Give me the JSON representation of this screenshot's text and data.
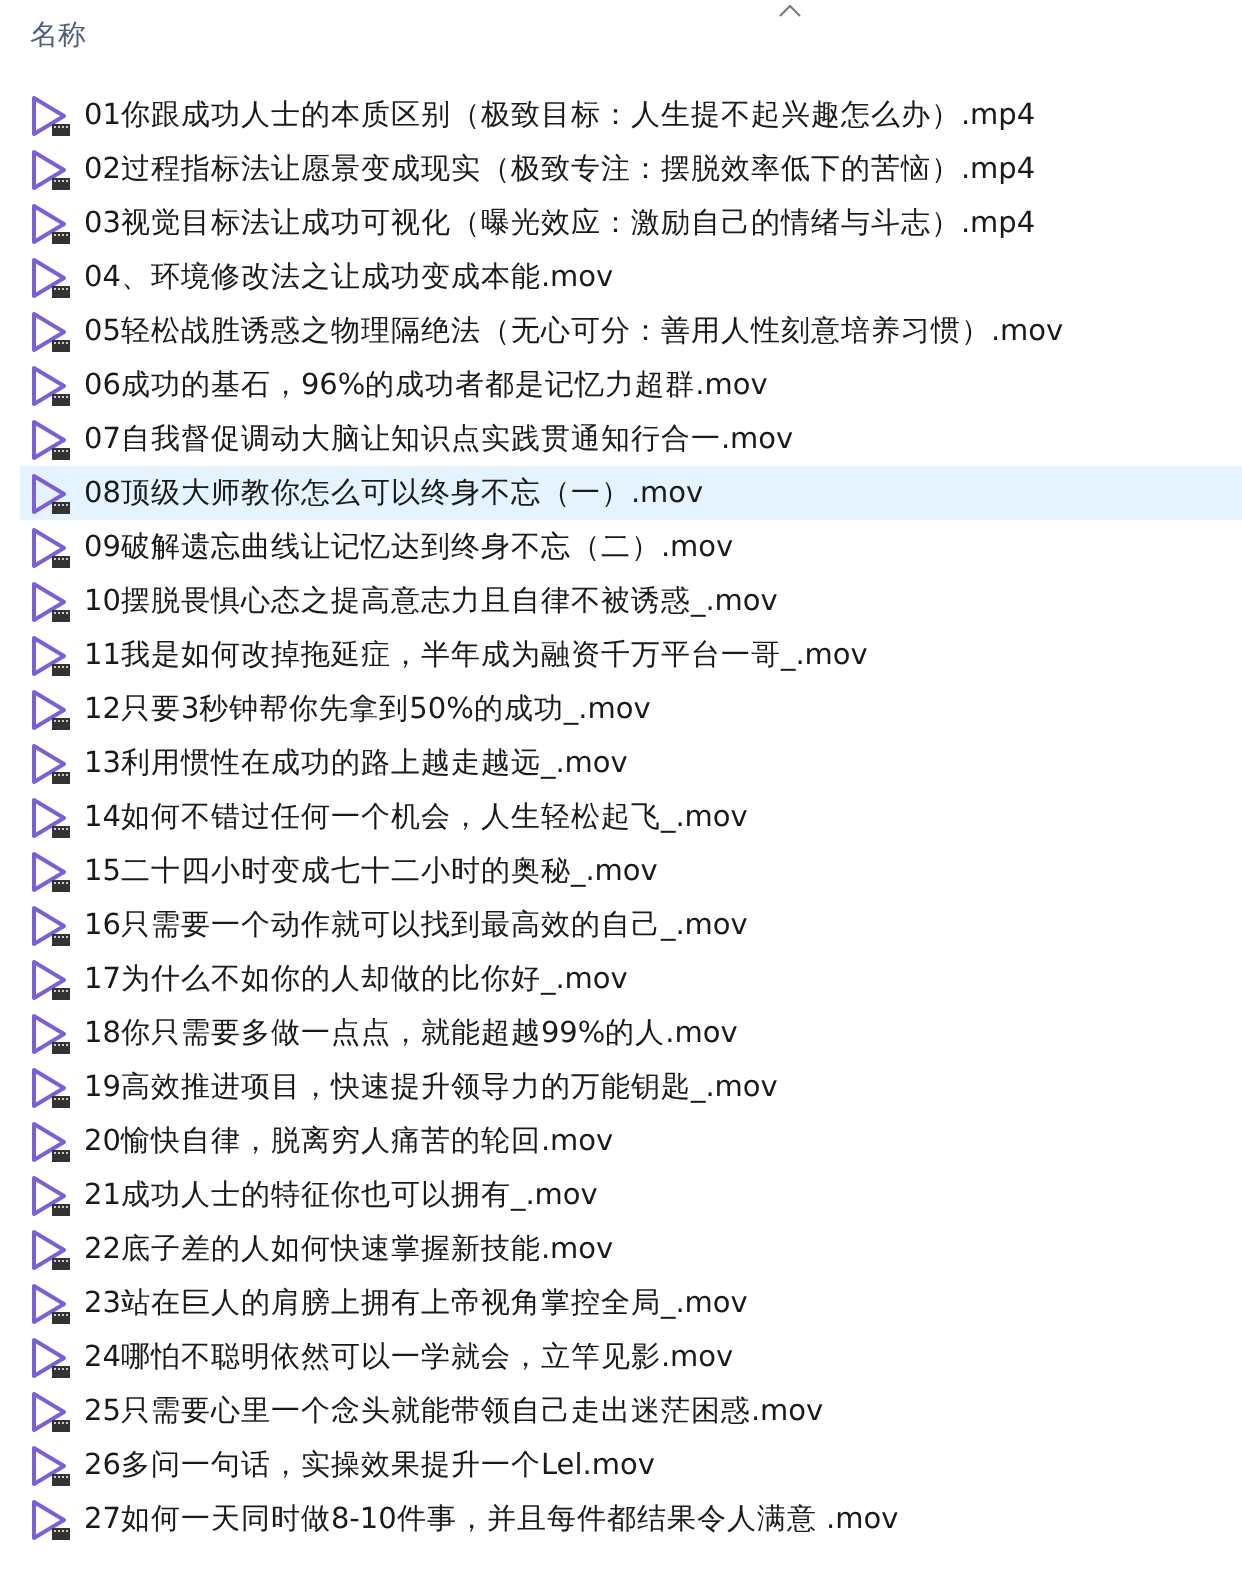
{
  "header": {
    "column": "名称",
    "sort_ascending": true
  },
  "files": [
    {
      "name": "01你跟成功人士的本质区别（极致目标：人生提不起兴趣怎么办）.mp4",
      "selected": false
    },
    {
      "name": "02过程指标法让愿景变成现实（极致专注：摆脱效率低下的苦恼）.mp4",
      "selected": false
    },
    {
      "name": "03视觉目标法让成功可视化（曝光效应：激励自己的情绪与斗志）.mp4",
      "selected": false
    },
    {
      "name": "04、环境修改法之让成功变成本能.mov",
      "selected": false
    },
    {
      "name": "05轻松战胜诱惑之物理隔绝法（无心可分：善用人性刻意培养习惯）.mov",
      "selected": false
    },
    {
      "name": "06成功的基石，96%的成功者都是记忆力超群.mov",
      "selected": false
    },
    {
      "name": "07自我督促调动大脑让知识点实践贯通知行合一.mov",
      "selected": false
    },
    {
      "name": "08顶级大师教你怎么可以终身不忘（一）.mov",
      "selected": true
    },
    {
      "name": "09破解遗忘曲线让记忆达到终身不忘（二）.mov",
      "selected": false
    },
    {
      "name": "10摆脱畏惧心态之提高意志力且自律不被诱惑_.mov",
      "selected": false
    },
    {
      "name": "11我是如何改掉拖延症，半年成为融资千万平台一哥_.mov",
      "selected": false
    },
    {
      "name": "12只要3秒钟帮你先拿到50%的成功_.mov",
      "selected": false
    },
    {
      "name": "13利用惯性在成功的路上越走越远_.mov",
      "selected": false
    },
    {
      "name": "14如何不错过任何一个机会，人生轻松起飞_.mov",
      "selected": false
    },
    {
      "name": "15二十四小时变成七十二小时的奥秘_.mov",
      "selected": false
    },
    {
      "name": "16只需要一个动作就可以找到最高效的自己_.mov",
      "selected": false
    },
    {
      "name": "17为什么不如你的人却做的比你好_.mov",
      "selected": false
    },
    {
      "name": "18你只需要多做一点点，就能超越99%的人.mov",
      "selected": false
    },
    {
      "name": "19高效推进项目，快速提升领导力的万能钥匙_.mov",
      "selected": false
    },
    {
      "name": "20愉快自律，脱离穷人痛苦的轮回.mov",
      "selected": false
    },
    {
      "name": "21成功人士的特征你也可以拥有_.mov",
      "selected": false
    },
    {
      "name": "22底子差的人如何快速掌握新技能.mov",
      "selected": false
    },
    {
      "name": "23站在巨人的肩膀上拥有上帝视角掌控全局_.mov",
      "selected": false
    },
    {
      "name": "24哪怕不聪明依然可以一学就会，立竿见影.mov",
      "selected": false
    },
    {
      "name": "25只需要心里一个念头就能带领自己走出迷茫困惑.mov",
      "selected": false
    },
    {
      "name": "26多问一句话，实操效果提升一个Lel.mov",
      "selected": false
    },
    {
      "name": "27如何一天同时做8-10件事，并且每件都结果令人满意 .mov",
      "selected": false
    }
  ]
}
